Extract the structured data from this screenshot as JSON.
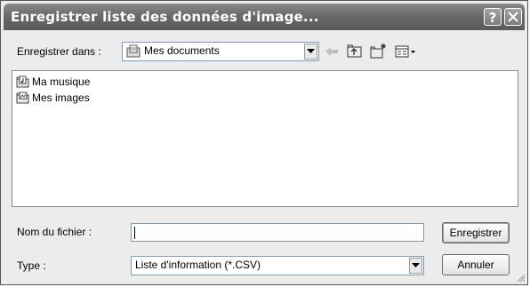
{
  "window": {
    "title": "Enregistrer liste des données d'image..."
  },
  "toolbar": {
    "save_in_label": "Enregistrer dans :",
    "save_in_value": "Mes documents",
    "icons": [
      "back-arrow-icon",
      "up-folder-icon",
      "new-folder-icon",
      "view-menu-icon"
    ]
  },
  "files": [
    {
      "name": "Ma musique",
      "icon": "folder-music-icon"
    },
    {
      "name": "Mes images",
      "icon": "folder-pictures-icon"
    }
  ],
  "form": {
    "filename_label": "Nom du fichier :",
    "filename_value": "",
    "type_label": "Type :",
    "type_value": "Liste d'information (*.CSV)"
  },
  "buttons": {
    "save": "Enregistrer",
    "cancel": "Annuler"
  }
}
